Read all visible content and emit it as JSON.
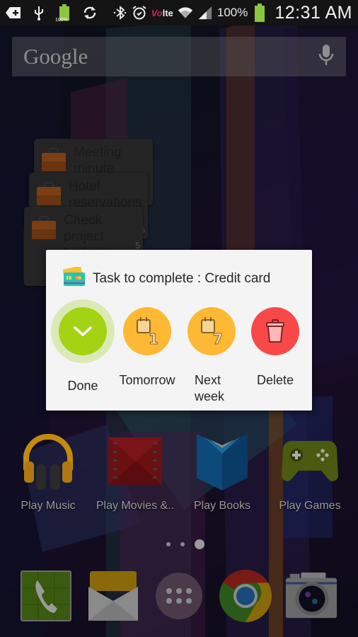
{
  "status_bar": {
    "left_icons": [
      "add-notification-icon",
      "usb-icon",
      "battery-100-icon",
      "sync-icon"
    ],
    "battery_small_label": "100%",
    "right_icons": [
      "bluetooth-icon",
      "alarm-icon",
      "volte-icon",
      "wifi-icon",
      "signal-icon",
      "battery-icon"
    ],
    "volte_label": "Vo",
    "lte_label": "lte",
    "battery_percent": "100%",
    "time": "12:31 AM"
  },
  "search": {
    "logo_text": "Google",
    "mic_icon": "microphone-icon"
  },
  "task_widget": {
    "tasks": [
      {
        "title": "Meeting minute",
        "icon": "briefcase-icon"
      },
      {
        "title": "Hotel reservations",
        "icon": "briefcase-icon",
        "suffix": "5"
      },
      {
        "title": "Check project budget",
        "icon": "briefcase-icon",
        "suffix": "5"
      }
    ]
  },
  "dialog": {
    "icon": "credit-card-icon",
    "title": "Task to complete : Credit card",
    "actions": [
      {
        "label": "Done",
        "icon": "check-icon",
        "color": "#a3d313"
      },
      {
        "label": "Tomorrow",
        "icon": "calendar-plus-1-icon",
        "badge": "1",
        "color": "#fdb934"
      },
      {
        "label": "Next week",
        "label_line1": "Next",
        "label_line2": "week",
        "icon": "calendar-plus-7-icon",
        "badge": "7",
        "color": "#fdb934"
      },
      {
        "label": "Delete",
        "icon": "trash-icon",
        "color": "#f94848"
      }
    ]
  },
  "home_apps": [
    {
      "label": "Play Music",
      "icon": "play-music-icon"
    },
    {
      "label": "Play Movies &..",
      "icon": "play-movies-icon"
    },
    {
      "label": "Play Books",
      "icon": "play-books-icon"
    },
    {
      "label": "Play Games",
      "icon": "play-games-icon"
    }
  ],
  "page_indicator": {
    "pages": 3,
    "current": 3
  },
  "dock": [
    {
      "label": "Phone",
      "icon": "phone-icon"
    },
    {
      "label": "Email",
      "icon": "email-icon"
    },
    {
      "label": "Apps",
      "icon": "app-drawer-icon"
    },
    {
      "label": "Chrome",
      "icon": "chrome-icon"
    },
    {
      "label": "Camera",
      "icon": "camera-icon"
    }
  ]
}
